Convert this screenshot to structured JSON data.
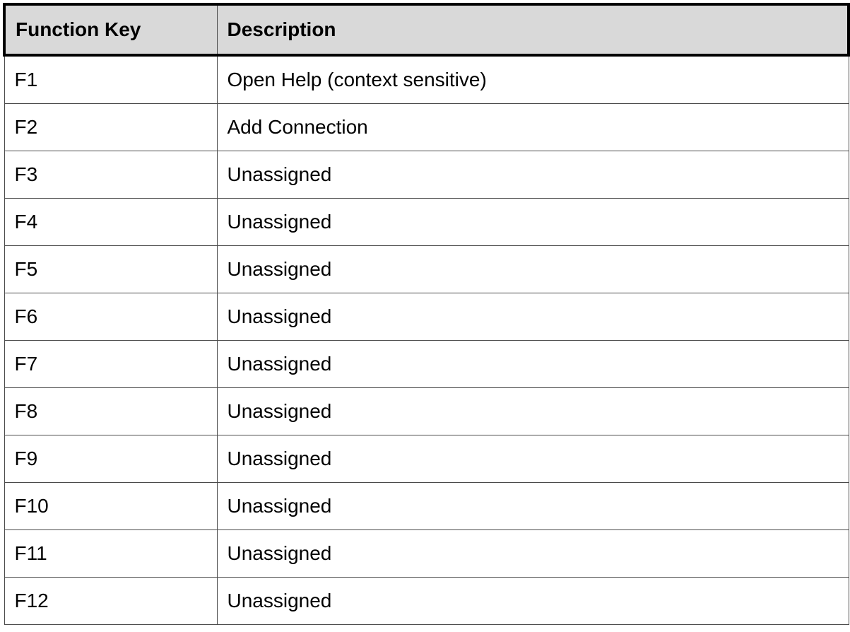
{
  "table": {
    "headers": {
      "key": "Function Key",
      "description": "Description"
    },
    "rows": [
      {
        "key": "F1",
        "description": "Open Help (context sensitive)"
      },
      {
        "key": "F2",
        "description": "Add Connection"
      },
      {
        "key": "F3",
        "description": "Unassigned"
      },
      {
        "key": "F4",
        "description": "Unassigned"
      },
      {
        "key": "F5",
        "description": "Unassigned"
      },
      {
        "key": "F6",
        "description": "Unassigned"
      },
      {
        "key": "F7",
        "description": "Unassigned"
      },
      {
        "key": "F8",
        "description": "Unassigned"
      },
      {
        "key": "F9",
        "description": "Unassigned"
      },
      {
        "key": "F10",
        "description": "Unassigned"
      },
      {
        "key": "F11",
        "description": "Unassigned"
      },
      {
        "key": "F12",
        "description": "Unassigned"
      }
    ]
  },
  "colors": {
    "header_background": "#d9d9d9",
    "border": "#4a4a4a",
    "header_border": "#000000"
  }
}
